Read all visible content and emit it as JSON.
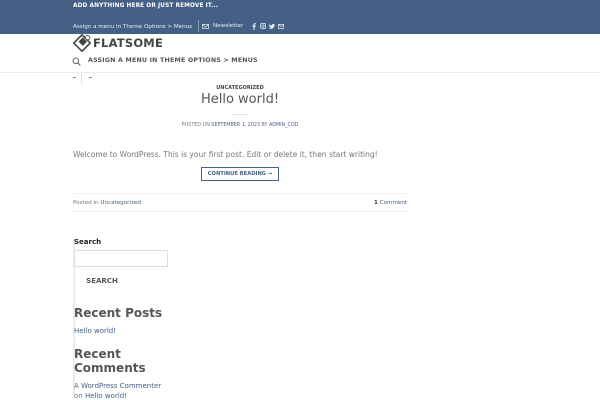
{
  "colors": {
    "primary": "#446084",
    "header_bg": "#446084",
    "link": "#446084"
  },
  "topbar": {
    "promo_text": "ADD ANYTHING HERE OR JUST REMOVE IT...",
    "menu_text": "Assign a menu in Theme Options > Menus",
    "newsletter_label": "Newsletter",
    "social_icons": [
      "facebook-icon",
      "instagram-icon",
      "twitter-icon",
      "email-icon"
    ]
  },
  "header": {
    "logo_text": "FLATSOME",
    "nav_text": "ASSIGN A MENU IN THEME OPTIONS > MENUS",
    "search_icon": "search-icon"
  },
  "post": {
    "category": "UNCATEGORIZED",
    "title": "Hello world!",
    "meta_prefix": "POSTED ON",
    "meta_date": "SEPTEMBER 1, 2023",
    "meta_by": "BY",
    "meta_author": "ADMIN_COD",
    "excerpt": "Welcome to WordPress. This is your first post. Edit or delete it, then start writing!",
    "continue_label": "CONTINUE READING →",
    "posted_in_label": "Posted in",
    "posted_in_category": "Uncategorized",
    "comments_count": "1",
    "comments_label": "Comment"
  },
  "sidebar": {
    "search_label": "Search",
    "search_value": "",
    "search_button": "SEARCH",
    "recent_posts_title": "Recent Posts",
    "recent_posts": [
      "Hello world!"
    ],
    "recent_comments_title": "Recent Comments",
    "commenter": "A WordPress Commenter",
    "comment_on": "on",
    "comment_post": "Hello world!"
  }
}
